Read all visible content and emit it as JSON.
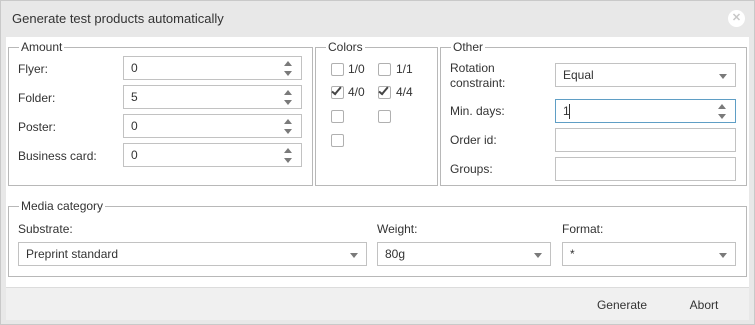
{
  "dialog": {
    "title": "Generate test products automatically",
    "close_icon": "close-icon"
  },
  "amount": {
    "legend": "Amount",
    "rows": [
      {
        "label": "Flyer:",
        "value": "0"
      },
      {
        "label": "Folder:",
        "value": "5"
      },
      {
        "label": "Poster:",
        "value": "0"
      },
      {
        "label": "Business card:",
        "value": "0"
      }
    ]
  },
  "colors": {
    "legend": "Colors",
    "options": [
      {
        "label": "1/0",
        "checked": false
      },
      {
        "label": "1/1",
        "checked": false
      },
      {
        "label": "4/0",
        "checked": true
      },
      {
        "label": "4/4",
        "checked": true
      },
      {
        "label": "",
        "checked": false
      },
      {
        "label": "",
        "checked": false
      },
      {
        "label": "",
        "checked": false
      }
    ]
  },
  "other": {
    "legend": "Other",
    "rotation_label": "Rotation constraint:",
    "rotation_value": "Equal",
    "min_days_label": "Min. days:",
    "min_days_value": "1",
    "order_id_label": "Order id:",
    "order_id_value": "",
    "groups_label": "Groups:",
    "groups_value": ""
  },
  "media": {
    "legend": "Media category",
    "substrate_label": "Substrate:",
    "substrate_value": "Preprint standard",
    "weight_label": "Weight:",
    "weight_value": "80g",
    "format_label": "Format:",
    "format_value": "*"
  },
  "footer": {
    "generate_label": "Generate",
    "abort_label": "Abort"
  },
  "colors_theme": {
    "focus_border": "#5f9ec5",
    "dialog_bg": "#e8e8e8"
  }
}
